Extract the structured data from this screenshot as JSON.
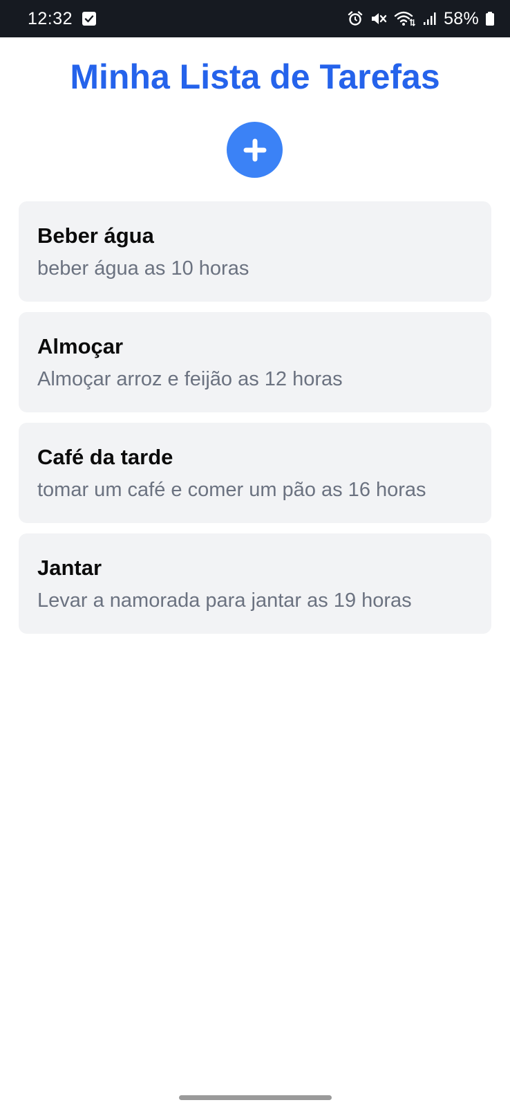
{
  "status_bar": {
    "time": "12:32",
    "battery_percent": "58%",
    "icons": [
      "checkbox-notification-icon",
      "alarm-icon",
      "mute-icon",
      "wifi-icon",
      "signal-icon",
      "battery-icon"
    ]
  },
  "app": {
    "title": "Minha Lista de Tarefas",
    "add_button_icon": "plus-icon"
  },
  "tasks": [
    {
      "title": "Beber água",
      "description": "beber água as 10 horas"
    },
    {
      "title": "Almoçar",
      "description": "Almoçar arroz e feijão as 12 horas"
    },
    {
      "title": "Café da tarde",
      "description": "tomar um café e comer um pão as 16 horas"
    },
    {
      "title": "Jantar",
      "description": "Levar a namorada para jantar as 19 horas"
    }
  ],
  "colors": {
    "title": "#2563eb",
    "add_button": "#3b82f6",
    "card_background": "#f2f3f5",
    "description": "#6b7280",
    "status_bar": "#161a21"
  }
}
